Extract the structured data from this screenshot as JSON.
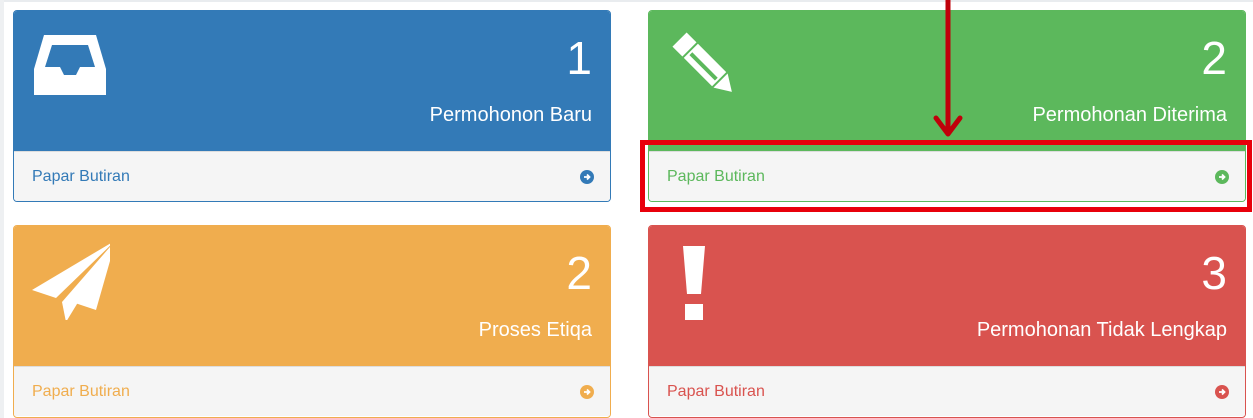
{
  "panels": [
    {
      "count": "1",
      "title": "Permohonon Baru",
      "footer_label": "Papar Butiran",
      "icon": "inbox-icon",
      "color": "#337ab7"
    },
    {
      "count": "2",
      "title": "Permohonan Diterima",
      "footer_label": "Papar Butiran",
      "icon": "pencil-icon",
      "color": "#5cb85c"
    },
    {
      "count": "2",
      "title": "Proses Etiqa",
      "footer_label": "Papar Butiran",
      "icon": "paper-plane-icon",
      "color": "#f0ad4e"
    },
    {
      "count": "3",
      "title": "Permohonan Tidak Lengkap",
      "footer_label": "Papar Butiran",
      "icon": "exclamation-icon",
      "color": "#d9534f"
    }
  ],
  "annotation": {
    "highlight_color": "#e8000b"
  }
}
